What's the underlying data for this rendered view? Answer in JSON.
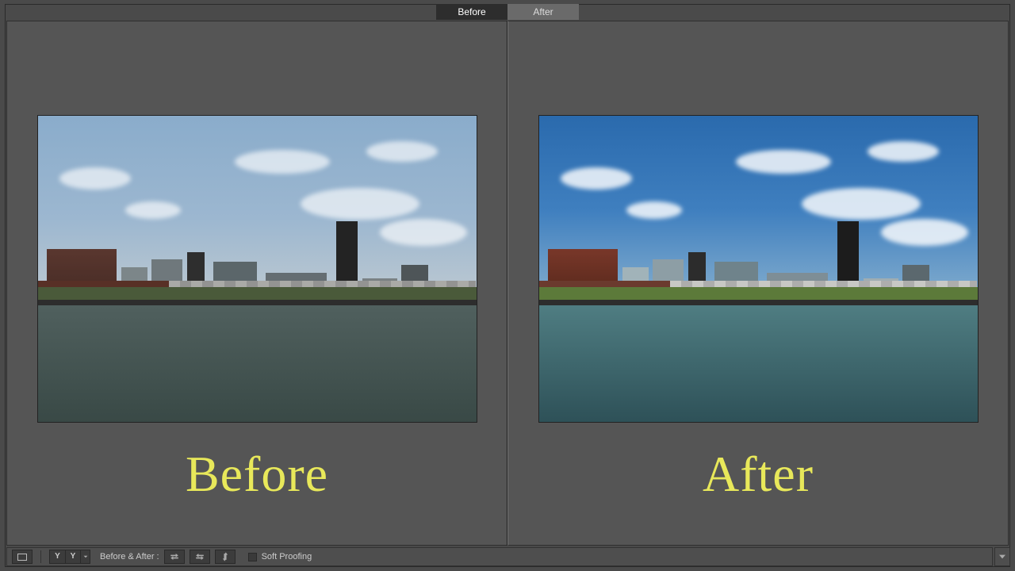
{
  "tabs": {
    "before": "Before",
    "after": "After",
    "active": "before"
  },
  "captions": {
    "before": "Before",
    "after": "After"
  },
  "toolbar": {
    "compare_mode_label": "Y|Y",
    "before_after_label": "Before & After :",
    "soft_proofing_label": "Soft Proofing",
    "soft_proofing_checked": false
  },
  "colors": {
    "caption": "#e8e85a"
  }
}
